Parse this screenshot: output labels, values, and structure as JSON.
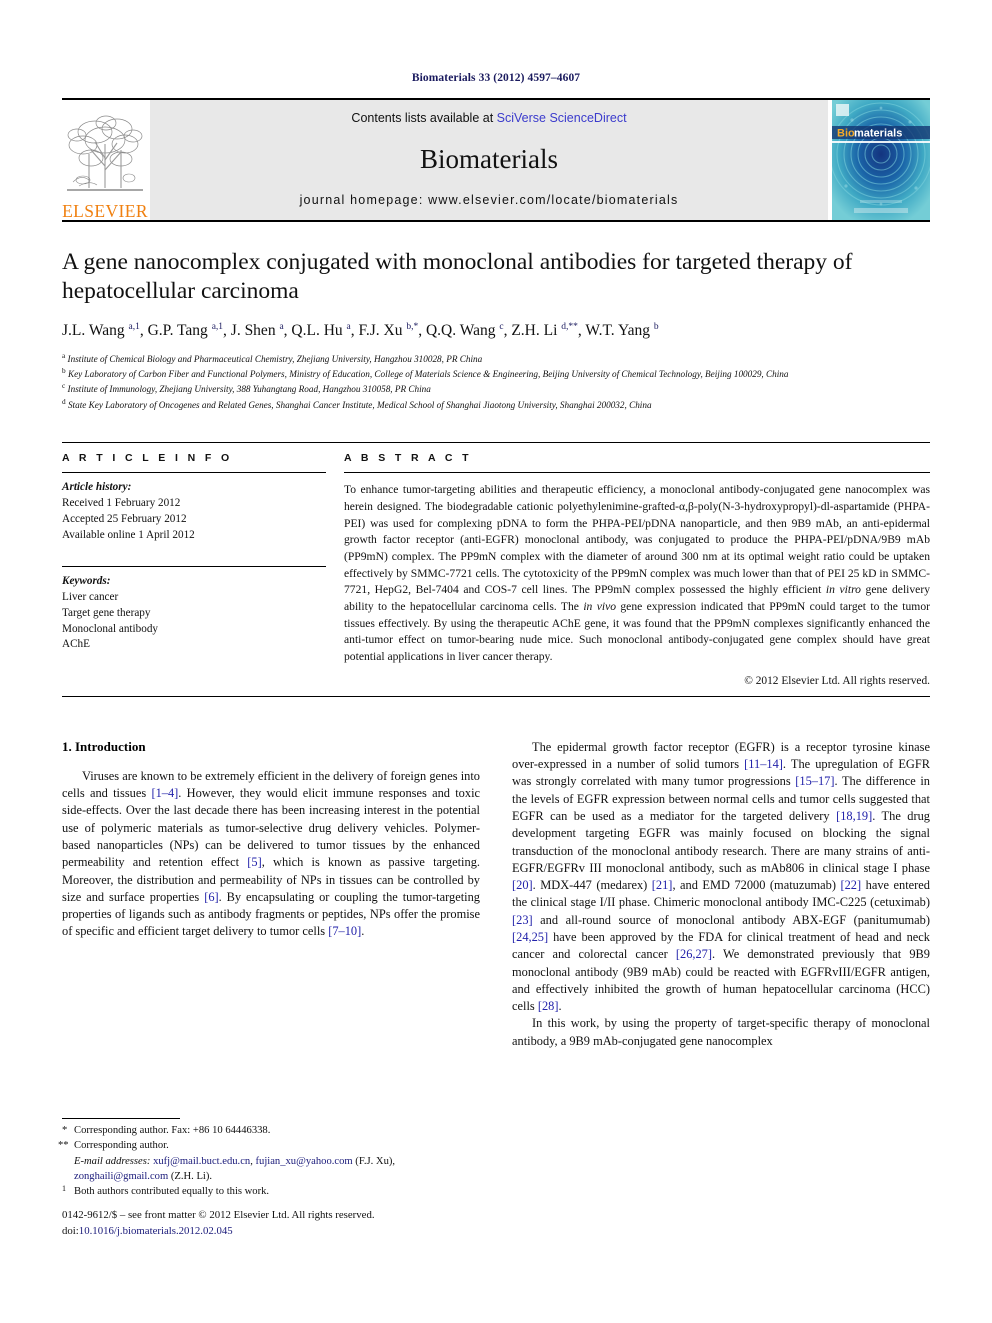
{
  "running_head": "Biomaterials 33 (2012) 4597–4607",
  "masthead": {
    "contents_prefix": "Contents lists available at ",
    "sciencedirect_link": "SciVerse ScienceDirect",
    "journal_name": "Biomaterials",
    "homepage": "journal homepage: www.elsevier.com/locate/biomaterials",
    "publisher_logo_text": "ELSEVIER",
    "cover_title_first": "Bio",
    "cover_title_rest": "materials",
    "accent_orange": "#f08010",
    "link_blue": "#3b3bcc",
    "cover_teal": "#2a9bb5"
  },
  "article": {
    "title": "A gene nanocomplex conjugated with monoclonal antibodies for targeted therapy of hepatocellular carcinoma",
    "authors_html": "J.L. Wang <sup>a,1</sup>, G.P. Tang <sup>a,1</sup>, J. Shen <sup>a</sup>, Q.L. Hu <sup>a</sup>, F.J. Xu <sup>b,*</sup>, Q.Q. Wang <sup>c</sup>, Z.H. Li <sup>d,**</sup>, W.T. Yang <sup>b</sup>",
    "affiliations": [
      "<sup>a</sup> Institute of Chemical Biology and Pharmaceutical Chemistry, Zhejiang University, Hangzhou 310028, PR China",
      "<sup>b</sup> Key Laboratory of Carbon Fiber and Functional Polymers, Ministry of Education, College of Materials Science &amp; Engineering, Beijing University of Chemical Technology, Beijing 100029, China",
      "<sup>c</sup> Institute of Immunology, Zhejiang University, 388 Yuhangtang Road, Hangzhou 310058, PR China",
      "<sup>d</sup> State Key Laboratory of Oncogenes and Related Genes, Shanghai Cancer Institute, Medical School of Shanghai Jiaotong University, Shanghai 200032, China"
    ]
  },
  "article_info": {
    "label": "A R T I C L E   I N F O",
    "history_title": "Article history:",
    "history": [
      "Received 1 February 2012",
      "Accepted 25 February 2012",
      "Available online 1 April 2012"
    ],
    "keywords_title": "Keywords:",
    "keywords": [
      "Liver cancer",
      "Target gene therapy",
      "Monoclonal antibody",
      "AChE"
    ]
  },
  "abstract": {
    "label": "A B S T R A C T",
    "text_html": "To enhance tumor-targeting abilities and therapeutic efficiency, a monoclonal antibody-conjugated gene nanocomplex was herein designed. The biodegradable cationic polyethylenimine-grafted-&alpha;,&beta;-poly(N-3-hydroxypropyl)-<span class=\"sc\">dl</span>-aspartamide (PHPA-PEI) was used for complexing pDNA to form the PHPA-PEI/pDNA nanoparticle, and then 9B9 mAb, an anti-epidermal growth factor receptor (anti-EGFR) monoclonal antibody, was conjugated to produce the PHPA-PEI/pDNA/9B9 mAb (PP9mN) complex. The PP9mN complex with the diameter of around 300 nm at its optimal weight ratio could be uptaken effectively by SMMC-7721 cells. The cytotoxicity of the PP9mN complex was much lower than that of PEI 25 kD in SMMC-7721, HepG2, Bel-7404 and COS-7 cell lines. The PP9mN complex possessed the highly efficient <i>in vitro</i> gene delivery ability to the hepatocellular carcinoma cells. The <i>in vivo</i> gene expression indicated that PP9mN could target to the tumor tissues effectively. By using the therapeutic AChE gene, it was found that the PP9mN complexes significantly enhanced the anti-tumor effect on tumor-bearing nude mice. Such monoclonal antibody-conjugated gene complex should have great potential applications in liver cancer therapy.",
    "copyright": "© 2012 Elsevier Ltd. All rights reserved."
  },
  "introduction": {
    "heading": "1. Introduction",
    "left_paragraphs_html": [
      "Viruses are known to be extremely efficient in the delivery of foreign genes into cells and tissues <span class=\"ref\">[1&ndash;4]</span>. However, they would elicit immune responses and toxic side-effects. Over the last decade there has been increasing interest in the potential use of polymeric materials as tumor-selective drug delivery vehicles. Polymer-based nanoparticles (NPs) can be delivered to tumor tissues by the enhanced permeability and retention effect <span class=\"ref\">[5]</span>, which is known as passive targeting. Moreover, the distribution and permeability of NPs in tissues can be controlled by size and surface properties <span class=\"ref\">[6]</span>. By encapsulating or coupling the tumor-targeting properties of ligands such as antibody fragments or peptides, NPs offer the promise of specific and efficient target delivery to tumor cells <span class=\"ref\">[7&ndash;10]</span>."
    ],
    "right_paragraphs_html": [
      "The epidermal growth factor receptor (EGFR) is a receptor tyrosine kinase over-expressed in a number of solid tumors <span class=\"ref\">[11&ndash;14]</span>. The upregulation of EGFR was strongly correlated with many tumor progressions <span class=\"ref\">[15&ndash;17]</span>. The difference in the levels of EGFR expression between normal cells and tumor cells suggested that EGFR can be used as a mediator for the targeted delivery <span class=\"ref\">[18,19]</span>. The drug development targeting EGFR was mainly focused on blocking the signal transduction of the monoclonal antibody research. There are many strains of anti-EGFR/EGFRv III monoclonal antibody, such as mAb806 in clinical stage I phase <span class=\"ref\">[20]</span>. MDX-447 (medarex) <span class=\"ref\">[21]</span>, and EMD 72000 (matuzumab) <span class=\"ref\">[22]</span> have entered the clinical stage I/II phase. Chimeric monoclonal antibody IMC-C225 (cetuximab) <span class=\"ref\">[23]</span> and all-round source of monoclonal antibody ABX-EGF (panitumumab) <span class=\"ref\">[24,25]</span> have been approved by the FDA for clinical treatment of head and neck cancer and colorectal cancer <span class=\"ref\">[26,27]</span>. We demonstrated previously that 9B9 monoclonal antibody (9B9 mAb) could be reacted with EGFRvIII/EGFR antigen, and effectively inhibited the growth of human hepatocellular carcinoma (HCC) cells <span class=\"ref\">[28]</span>.",
      "In this work, by using the property of target-specific therapy of monoclonal antibody, a 9B9 mAb-conjugated gene nanocomplex"
    ]
  },
  "footnotes": {
    "corresponding_1": "Corresponding author. Fax: +86 10 64446338.",
    "corresponding_1_mark": "*",
    "corresponding_2": "Corresponding author.",
    "corresponding_2_mark": "**",
    "email_label": "E-mail addresses:",
    "email_html": "<span class=\"lnk\">xufj@mail.buct.edu.cn</span>, <span class=\"lnk\">fujian_xu@yahoo.com</span> (F.J. Xu), <span class=\"lnk\">zonghaili@gmail.com</span> (Z.H. Li).",
    "equal_contrib_mark": "1",
    "equal_contrib": "Both authors contributed equally to this work."
  },
  "footer": {
    "front_matter": "0142-9612/$ – see front matter © 2012 Elsevier Ltd. All rights reserved.",
    "doi_label": "doi:",
    "doi_value": "10.1016/j.biomaterials.2012.02.045"
  }
}
